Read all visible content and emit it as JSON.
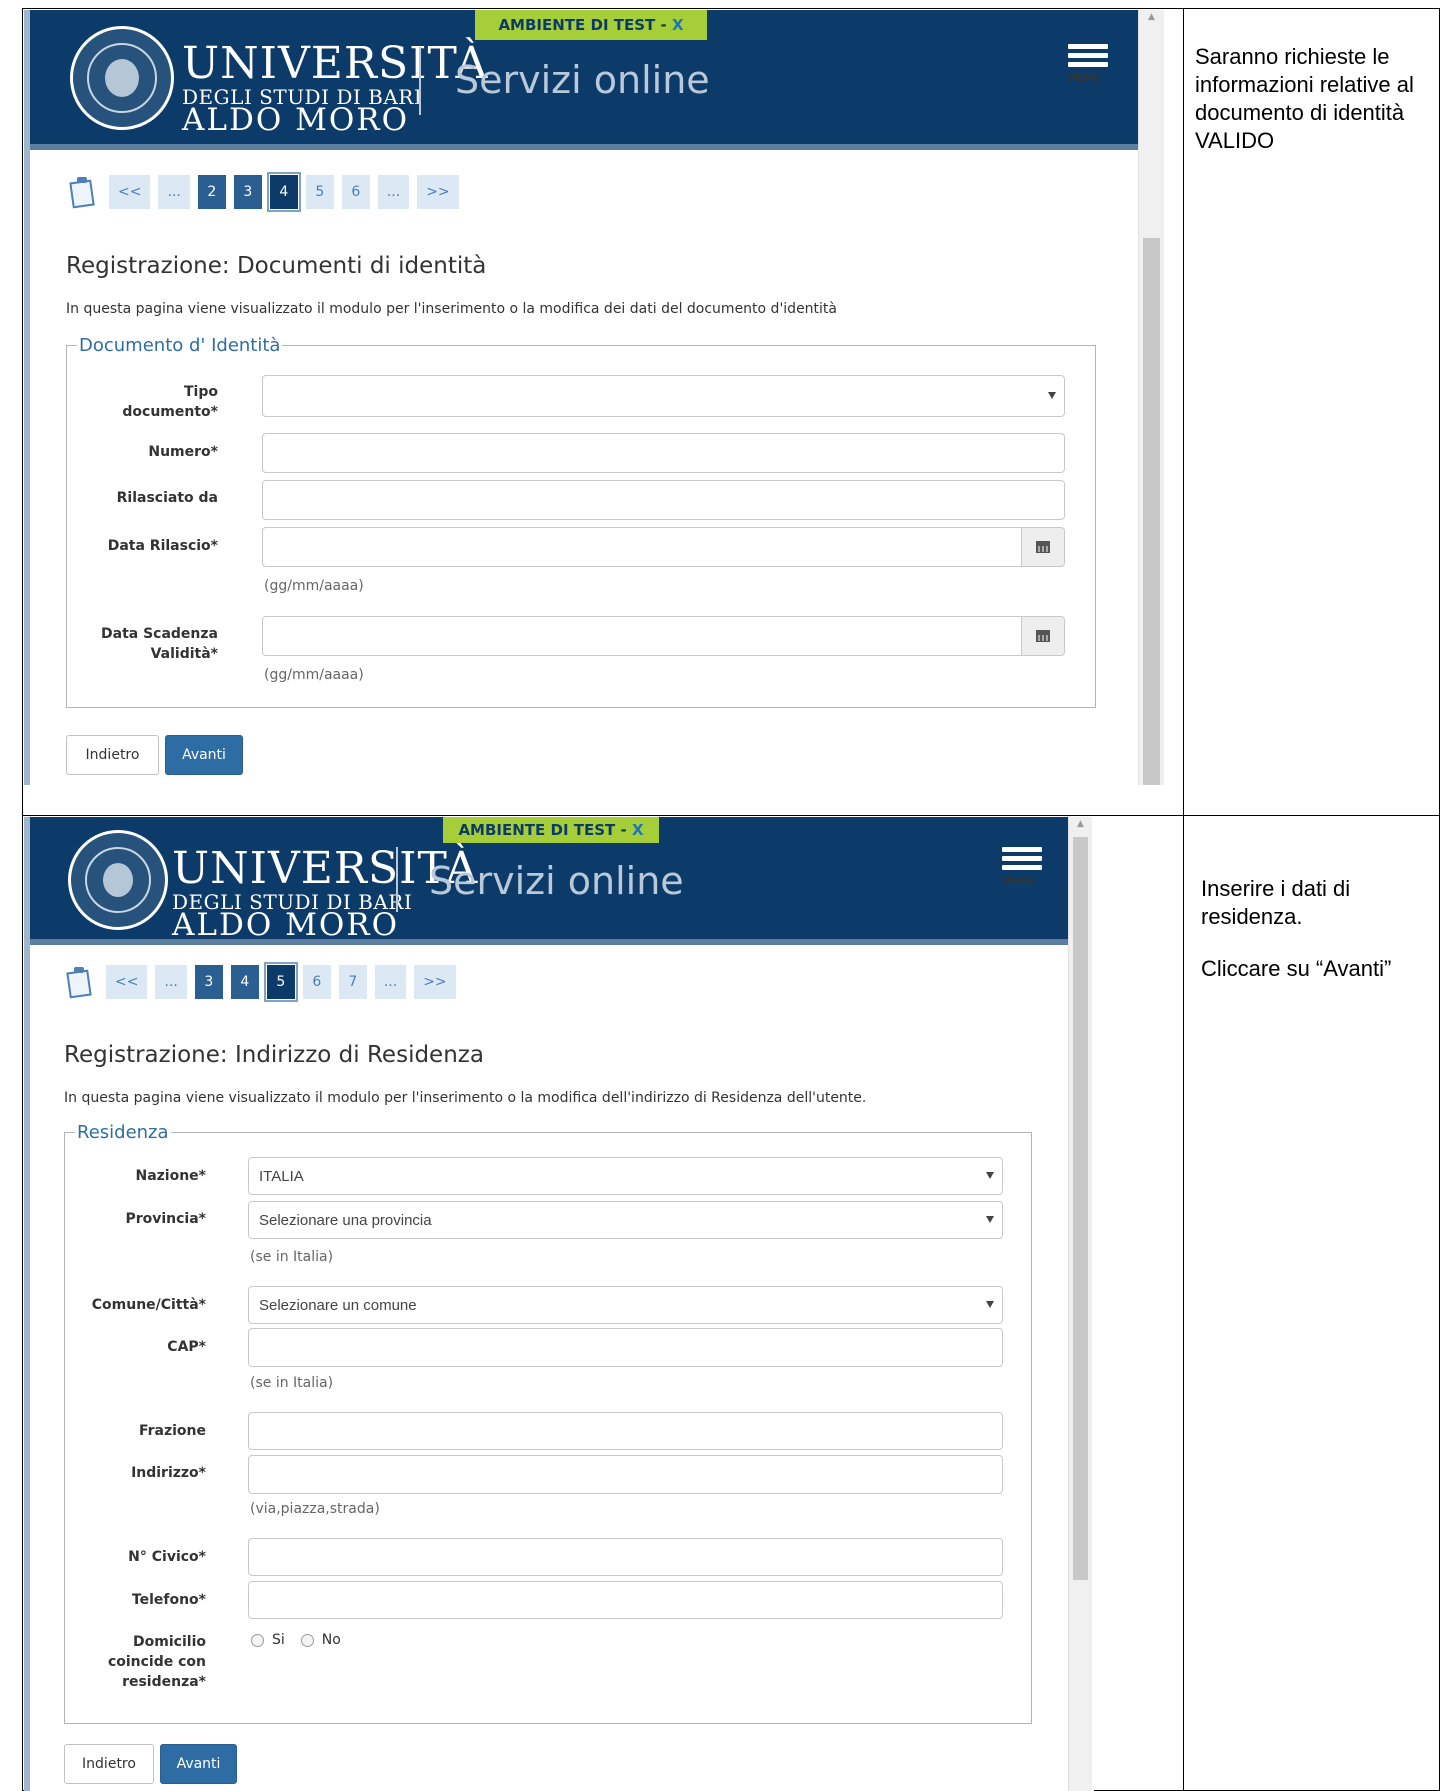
{
  "step1": {
    "header": {
      "uni_line1": "UNIVERSITÀ",
      "uni_line2": "DEGLI STUDI DI BARI",
      "uni_line3": "ALDO MORO",
      "servizi": "Servizi online",
      "banner": "AMBIENTE DI TEST - ",
      "banner_close": "X",
      "menu_label": "MENU"
    },
    "pager": [
      "<<",
      "...",
      "2",
      "3",
      "4",
      "5",
      "6",
      "...",
      ">>"
    ],
    "title": "Registrazione: Documenti di identità",
    "description": "In questa pagina viene visualizzato il modulo per l'inserimento o la modifica dei dati del documento d'identità",
    "fieldset_legend": "Documento d' Identità",
    "fields": {
      "tipo_documento": "Tipo documento*",
      "numero": "Numero*",
      "rilasciato_da": "Rilasciato da",
      "data_rilascio": "Data Rilascio*",
      "data_scadenza": "Data Scadenza Validità*"
    },
    "date_hint": "(gg/mm/aaaa)",
    "back_label": "Indietro",
    "next_label": "Avanti",
    "note": "Saranno richieste le informazioni relative al documento di identità VALIDO"
  },
  "step2": {
    "header": {
      "uni_line1": "UNIVERSITÀ",
      "uni_line2": "DEGLI STUDI DI BARI",
      "uni_line3": "ALDO MORO",
      "servizi": "Servizi online",
      "banner": "AMBIENTE DI TEST - ",
      "banner_close": "X",
      "menu_label": "MENU"
    },
    "pager": [
      "<<",
      "...",
      "3",
      "4",
      "5",
      "6",
      "7",
      "...",
      ">>"
    ],
    "title": "Registrazione: Indirizzo di Residenza",
    "description": "In questa pagina viene visualizzato il modulo per l'inserimento o la modifica dell'indirizzo di Residenza dell'utente.",
    "fieldset_legend": "Residenza",
    "fields": {
      "nazione": "Nazione*",
      "provincia": "Provincia*",
      "comune": "Comune/Città*",
      "cap": "CAP*",
      "frazione": "Frazione",
      "indirizzo": "Indirizzo*",
      "civico": "N° Civico*",
      "telefono": "Telefono*",
      "domicilio": "Domicilio coincide con residenza*"
    },
    "values": {
      "nazione": "ITALIA",
      "provincia": "Selezionare una provincia",
      "comune": "Selezionare un comune"
    },
    "hints": {
      "se_in_italia": "(se in Italia)",
      "indirizzo": "(via,piazza,strada)"
    },
    "radio": {
      "si": "Si",
      "no": "No"
    },
    "back_label": "Indietro",
    "next_label": "Avanti",
    "note_line1": "Inserire i dati di residenza.",
    "note_line2": "Cliccare su “Avanti”"
  }
}
